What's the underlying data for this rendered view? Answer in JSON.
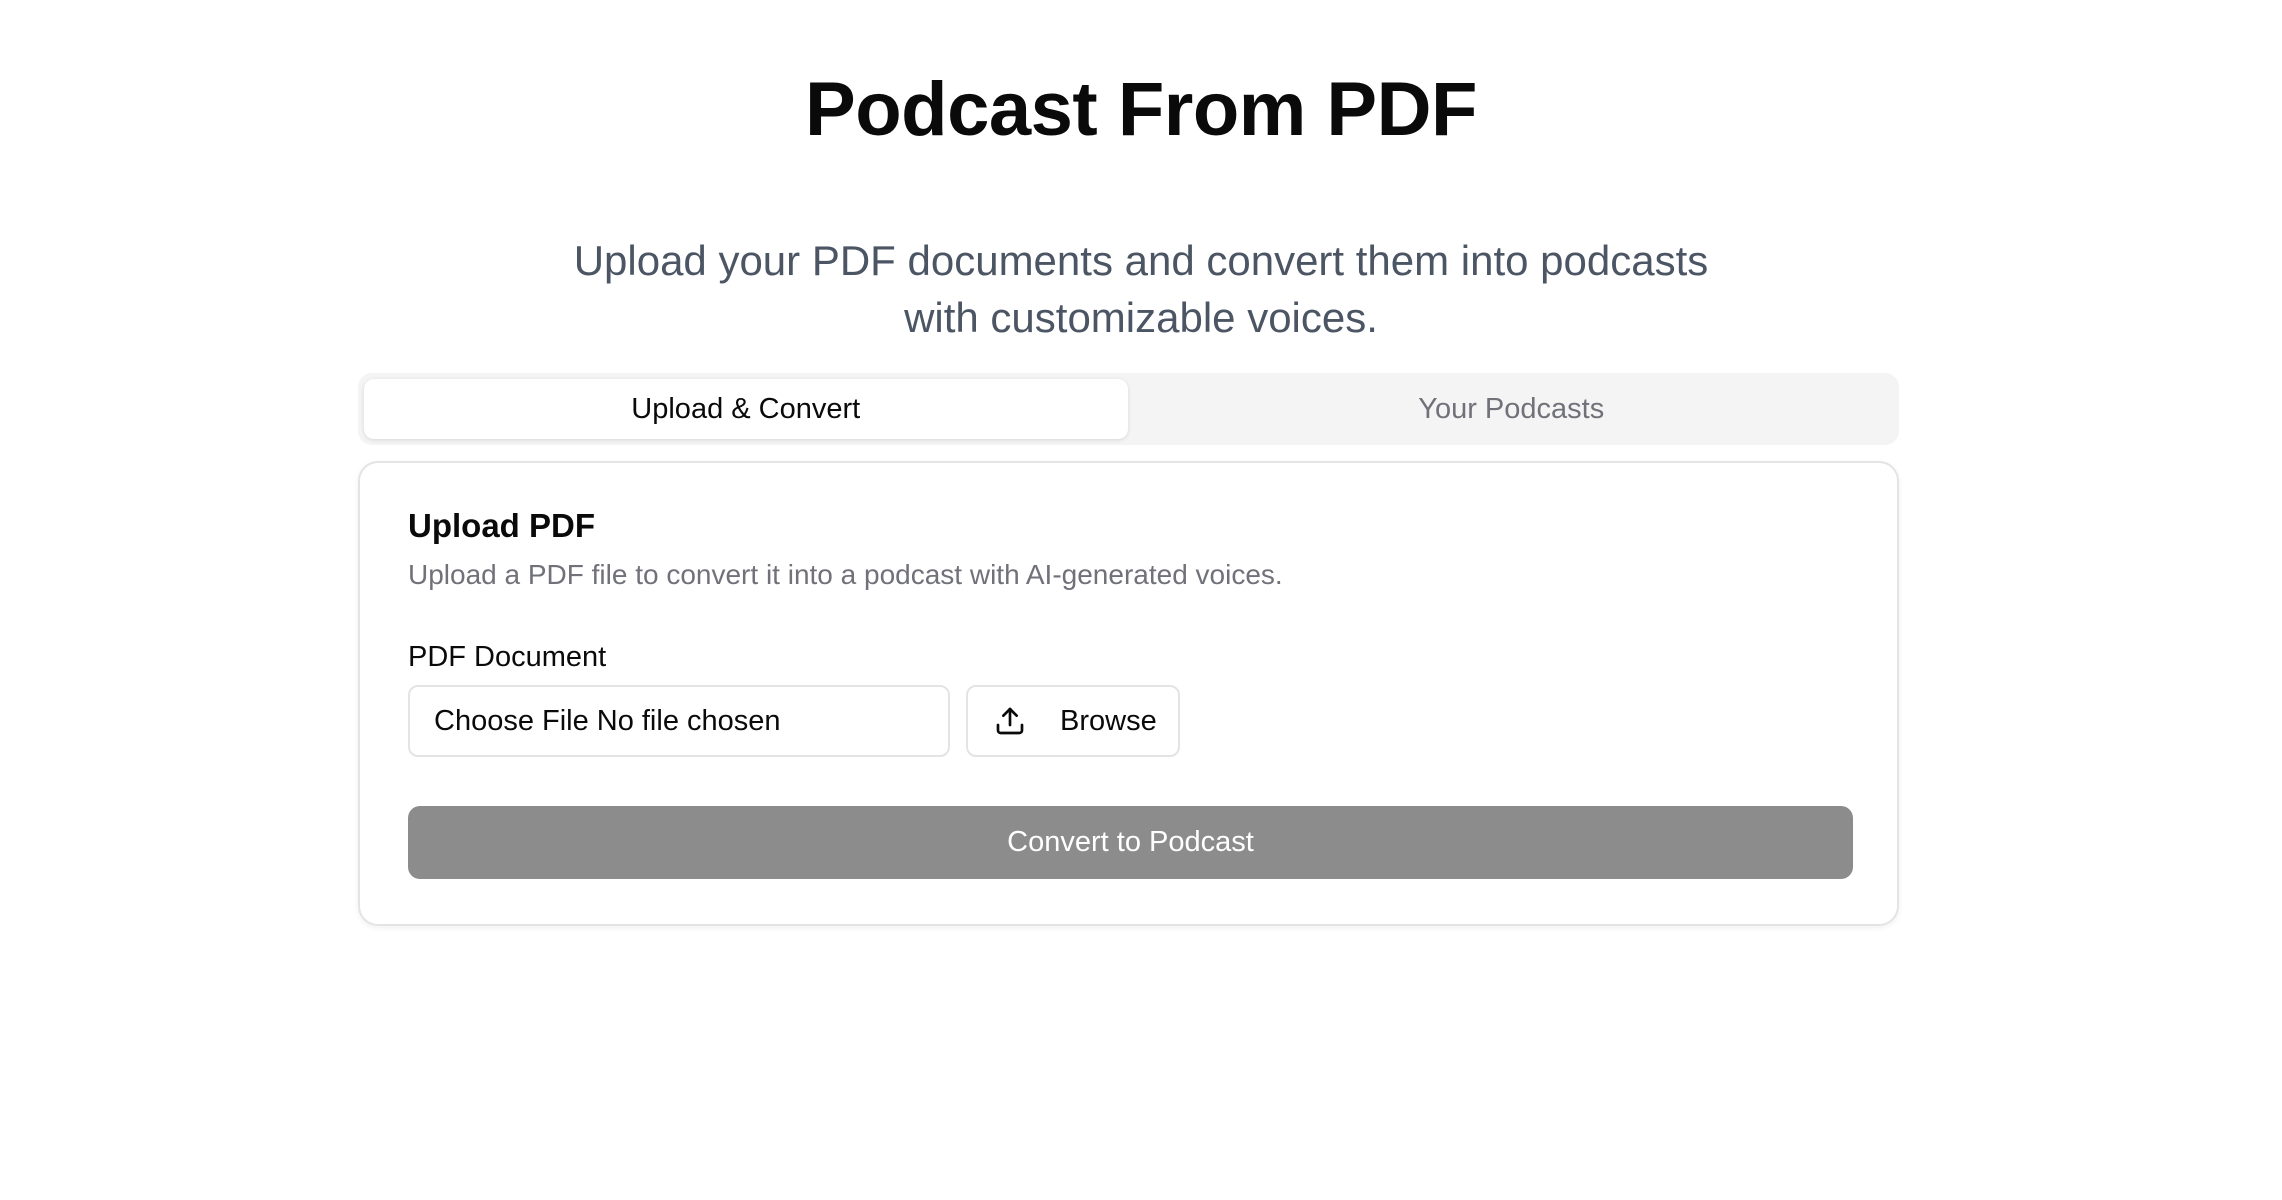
{
  "header": {
    "title": "Podcast From PDF",
    "subtitle": "Upload your PDF documents and convert them into podcasts with customizable voices."
  },
  "tabs": [
    {
      "label": "Upload & Convert",
      "active": true
    },
    {
      "label": "Your Podcasts",
      "active": false
    }
  ],
  "upload_card": {
    "title": "Upload PDF",
    "description": "Upload a PDF file to convert it into a podcast with AI-generated voices.",
    "field_label": "PDF Document",
    "file_input": {
      "button_label": "Choose File",
      "status": "No file chosen"
    },
    "browse_label": "Browse",
    "browse_icon": "upload-icon",
    "convert_label": "Convert to Podcast"
  },
  "colors": {
    "convert_button": "#8c8c8c",
    "tab_bar": "#f4f4f5",
    "subtitle_text": "#4b5563"
  }
}
